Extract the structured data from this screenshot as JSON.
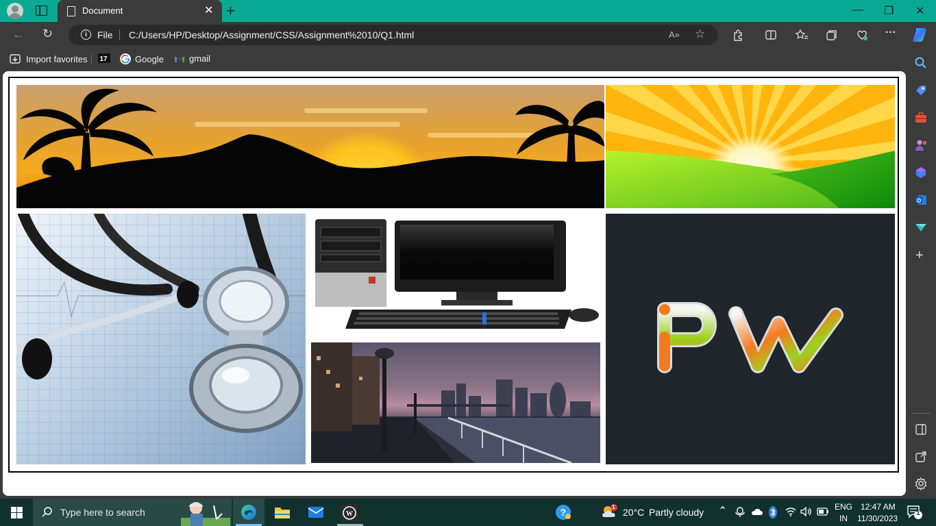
{
  "browser": {
    "tab": {
      "title": "Document",
      "close_glyph": "✕"
    },
    "new_tab_glyph": "+",
    "window_controls": {
      "minimize": "—",
      "restore": "❐",
      "close": "✕"
    },
    "address": {
      "scheme_label": "File",
      "url": "C:/Users/HP/Desktop/Assignment/CSS/Assignment%2010/Q1.html",
      "read_aloud_glyph": "A»",
      "favorite_glyph": "☆"
    },
    "favorites": [
      {
        "label": "Import favorites",
        "icon": "import-icon"
      },
      {
        "label": "",
        "icon": "tv-icon"
      },
      {
        "label": "Google",
        "icon": "google-icon"
      },
      {
        "label": "gmail",
        "icon": "gmail-icon"
      }
    ],
    "toolbar_icons": [
      "extensions-icon",
      "split-screen-icon",
      "favorites-icon",
      "collections-icon",
      "performance-icon",
      "more-icon",
      "copilot-icon"
    ],
    "sidebar_icons": [
      "search-icon",
      "tag-icon",
      "toolbox-icon",
      "games-icon",
      "office-icon",
      "outlook-icon",
      "send-icon",
      "add-icon",
      "sidebar-toggle-icon",
      "open-external-icon",
      "settings-icon"
    ],
    "more_glyph": "···",
    "add_glyph": "+"
  },
  "content": {
    "images": [
      "sunset-landscape",
      "sunrise-field",
      "stethoscope",
      "desktop-computer",
      "city-riverside",
      "pw-logo"
    ],
    "logo_text": "PW"
  },
  "taskbar": {
    "search_placeholder": "Type here to search",
    "weather": {
      "temp": "20°C",
      "desc": "Partly cloudy",
      "badge": "1"
    },
    "lang_top": "ENG",
    "lang_bottom": "IN",
    "time": "12:47 AM",
    "date": "11/30/2023",
    "notifications": "1"
  },
  "colors": {
    "titlebar": "#0aa993",
    "chrome": "#3b3b3b",
    "taskbar": "#10312e"
  }
}
